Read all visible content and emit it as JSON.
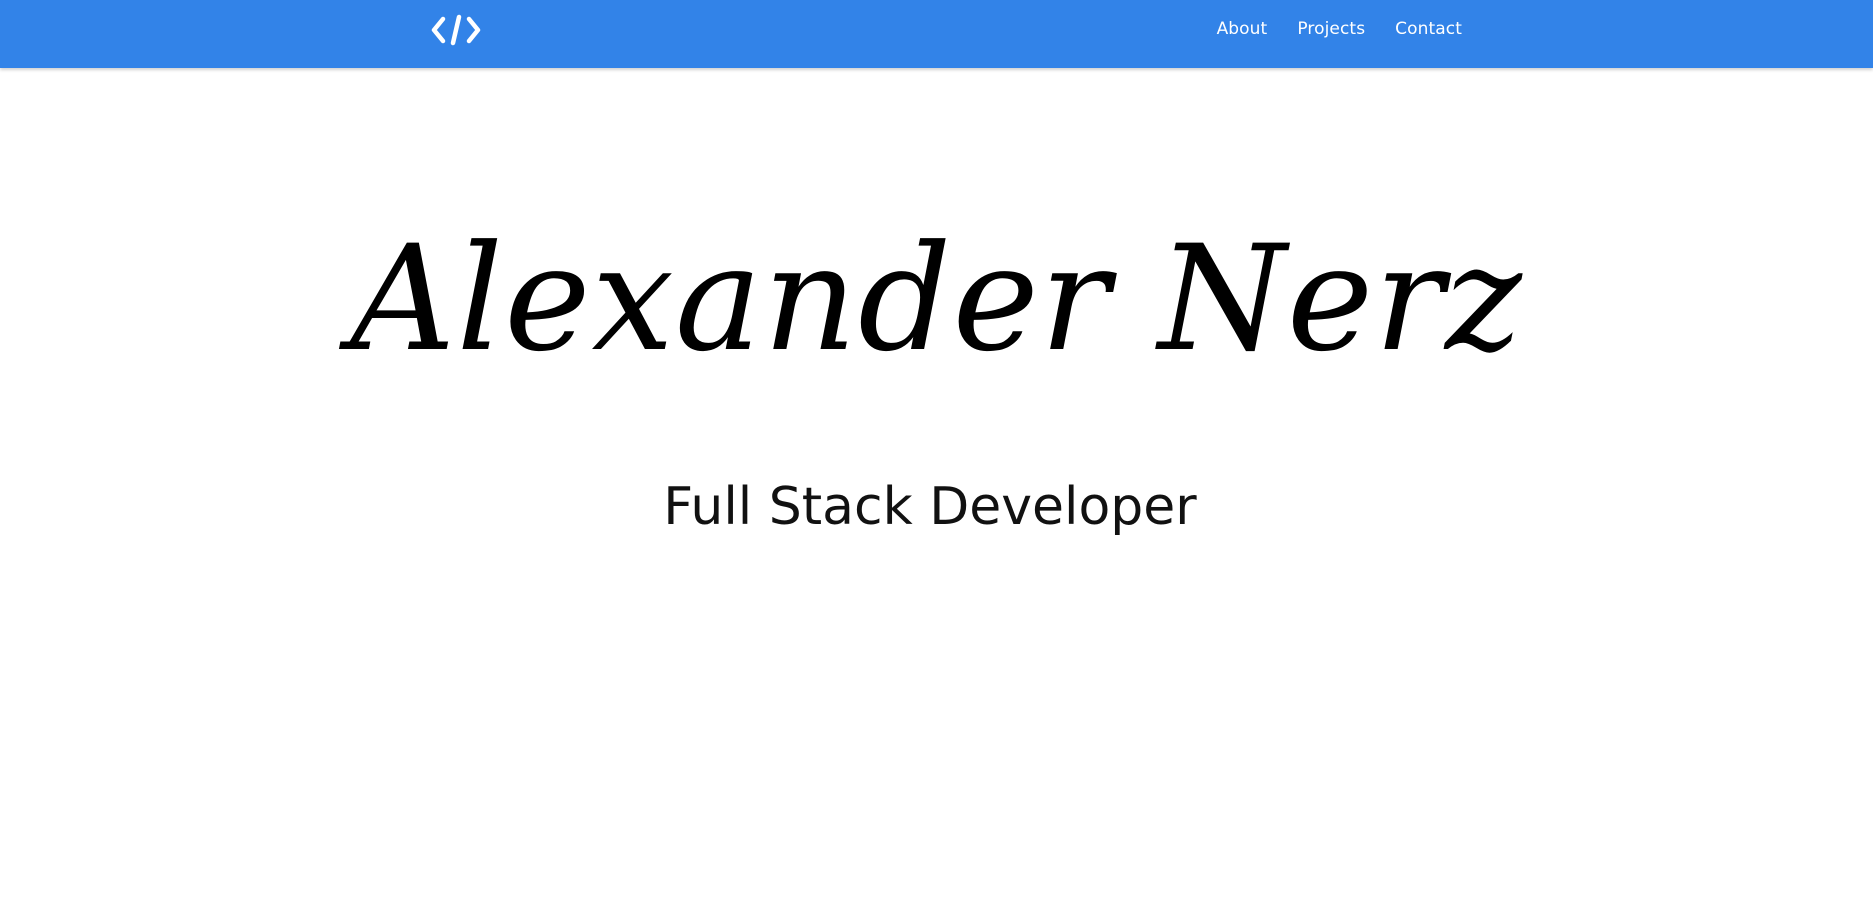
{
  "navbar": {
    "background_color": "#3283e8",
    "text_color": "#ffffff",
    "logo": {
      "icon": "code-brackets-icon"
    },
    "links": [
      {
        "label": "About"
      },
      {
        "label": "Projects"
      },
      {
        "label": "Contact"
      }
    ]
  },
  "hero": {
    "name": "Alexander Nerz",
    "subtitle": "Full Stack Developer"
  }
}
